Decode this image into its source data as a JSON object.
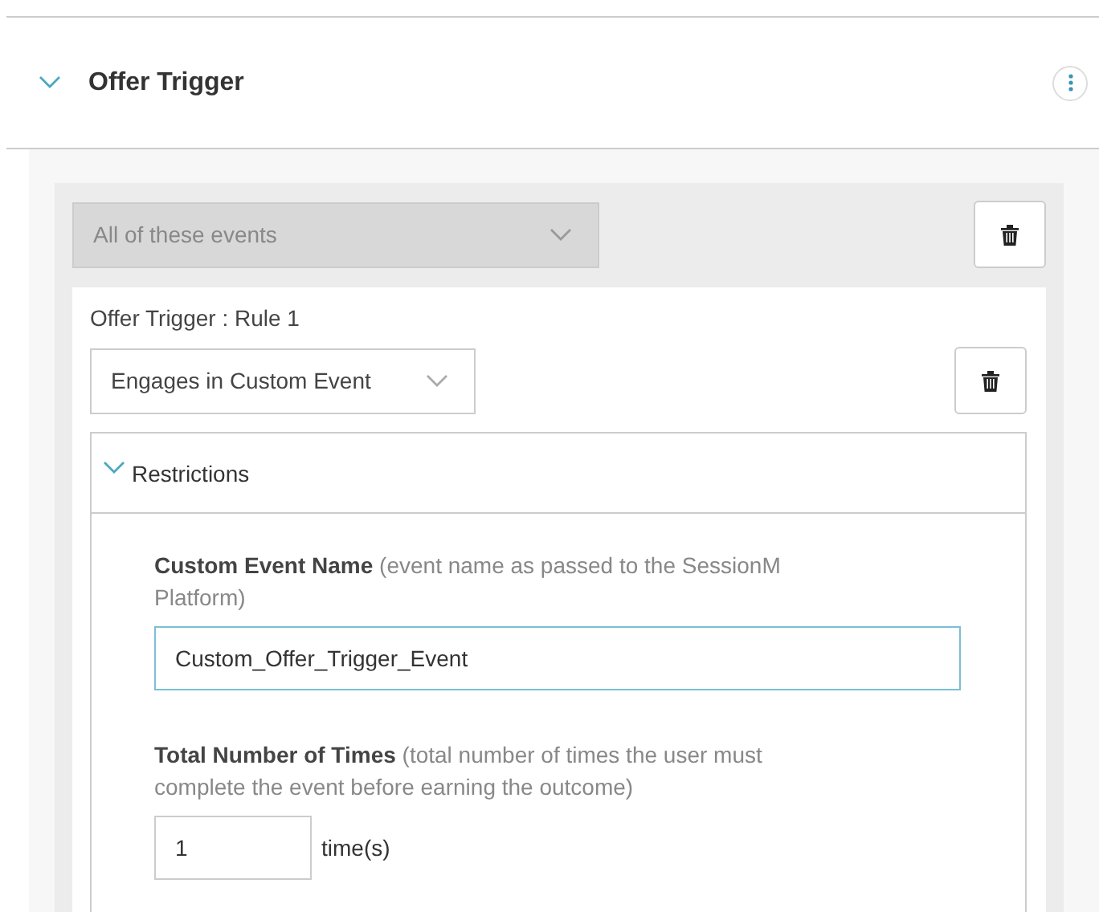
{
  "section": {
    "title": "Offer Trigger",
    "expanded": true
  },
  "group": {
    "mode": {
      "value": "All of these events",
      "disabled": true
    }
  },
  "rule": {
    "label": "Offer Trigger : Rule 1",
    "event": {
      "value": "Engages in Custom Event",
      "disabled": false
    }
  },
  "restrictions": {
    "title": "Restrictions",
    "expanded": true,
    "fields": [
      {
        "kind": "wide",
        "label": "Custom Event Name",
        "hint": "(event name as passed to the SessionM Platform)",
        "value": "Custom_Offer_Trigger_Event",
        "focused": true
      },
      {
        "kind": "short",
        "label": "Total Number of Times",
        "hint": "(total number of times the user must complete the event before earning the outcome)",
        "value": "1",
        "focused": false,
        "suffix": "time(s)"
      }
    ]
  }
}
